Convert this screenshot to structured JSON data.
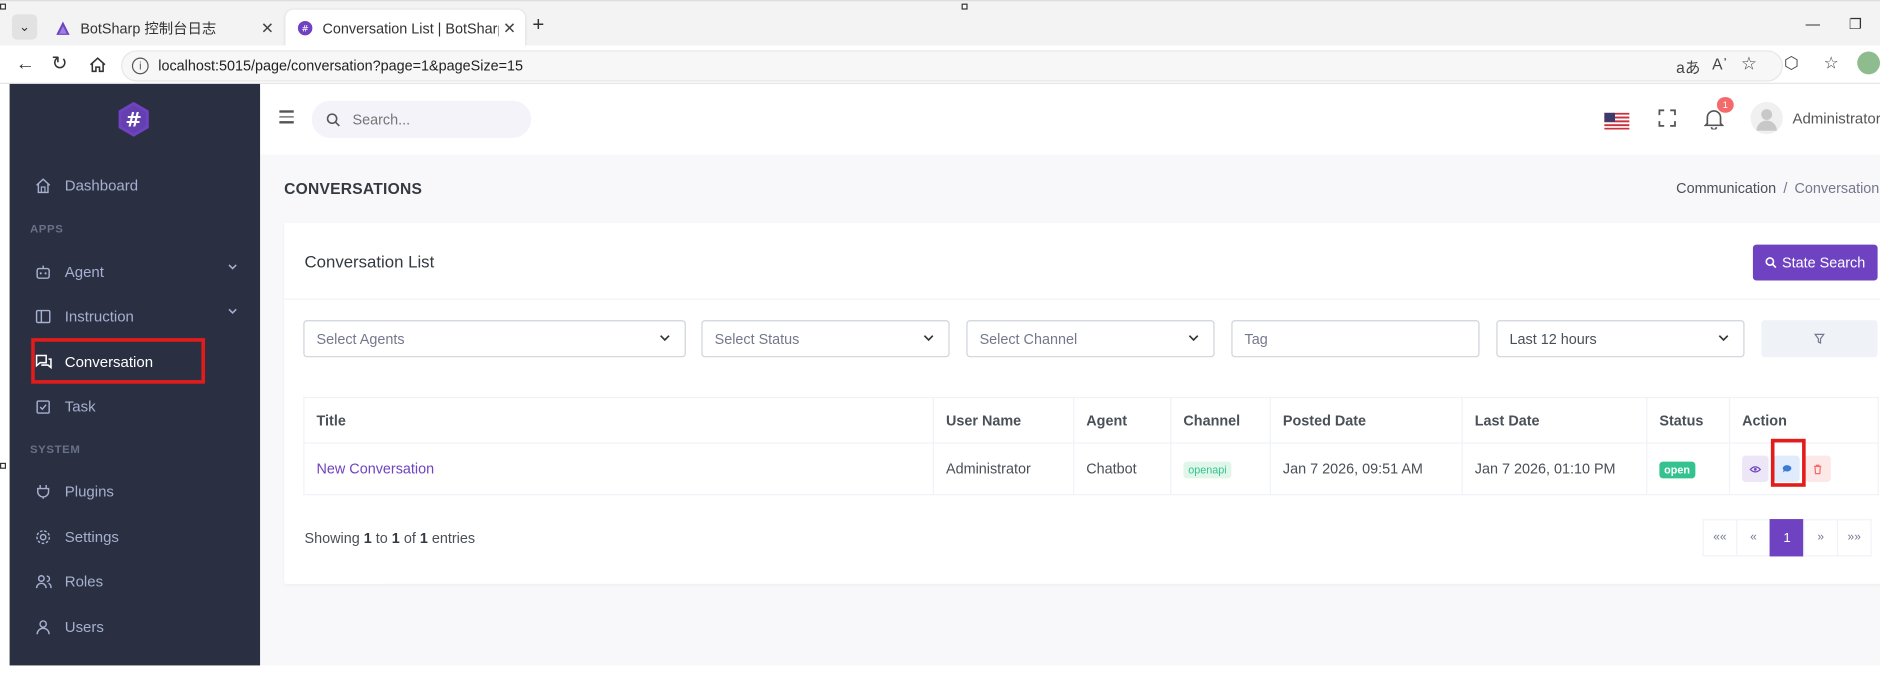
{
  "browser": {
    "tabs": [
      {
        "label": "BotSharp 控制台日志"
      },
      {
        "label": "Conversation List | BotSharp - Das"
      }
    ],
    "url": "localhost:5015/page/conversation?page=1&pageSize=15"
  },
  "sidebar": {
    "items": [
      {
        "label": "Dashboard",
        "icon": "home-icon"
      },
      {
        "label": "Agent",
        "icon": "robot-icon"
      },
      {
        "label": "Instruction",
        "icon": "book-icon"
      },
      {
        "label": "Conversation",
        "icon": "chat-icon"
      },
      {
        "label": "Task",
        "icon": "clipboard-icon"
      },
      {
        "label": "Plugins",
        "icon": "plug-icon"
      },
      {
        "label": "Settings",
        "icon": "gear-icon"
      },
      {
        "label": "Roles",
        "icon": "roles-icon"
      },
      {
        "label": "Users",
        "icon": "user-icon"
      }
    ],
    "sections": {
      "apps": "APPS",
      "system": "SYSTEM"
    }
  },
  "topbar": {
    "search_placeholder": "Search...",
    "notification_count": "1",
    "user_name": "Administrator"
  },
  "page": {
    "title": "CONVERSATIONS",
    "breadcrumb": {
      "parent": "Communication",
      "separator": "/",
      "current": "Conversation"
    }
  },
  "card": {
    "title": "Conversation List",
    "state_search_label": "State Search",
    "filters": {
      "agents": "Select Agents",
      "status": "Select Status",
      "channel": "Select Channel",
      "tag_placeholder": "Tag",
      "time_range": "Last 12 hours"
    },
    "table": {
      "headers": [
        "Title",
        "User Name",
        "Agent",
        "Channel",
        "Posted Date",
        "Last Date",
        "Status",
        "Action"
      ],
      "rows": [
        {
          "title": "New Conversation",
          "user_name": "Administrator",
          "agent": "Chatbot",
          "channel": "openapi",
          "posted_date": "Jan 7 2026, 09:51 AM",
          "last_date": "Jan 7 2026, 01:10 PM",
          "status": "open"
        }
      ]
    },
    "showing": {
      "prefix": "Showing",
      "from": "1",
      "to_word": "to",
      "to": "1",
      "of_word": "of",
      "total": "1",
      "suffix": "entries"
    },
    "pagination": {
      "first": "««",
      "prev": "«",
      "current": "1",
      "next": "»",
      "last": "»»"
    }
  },
  "colors": {
    "primary": "#6f42c1",
    "sidebar_bg": "#2a3042",
    "success": "#34c38f",
    "danger": "#f46a6a",
    "annotation": "#e21b1b"
  }
}
